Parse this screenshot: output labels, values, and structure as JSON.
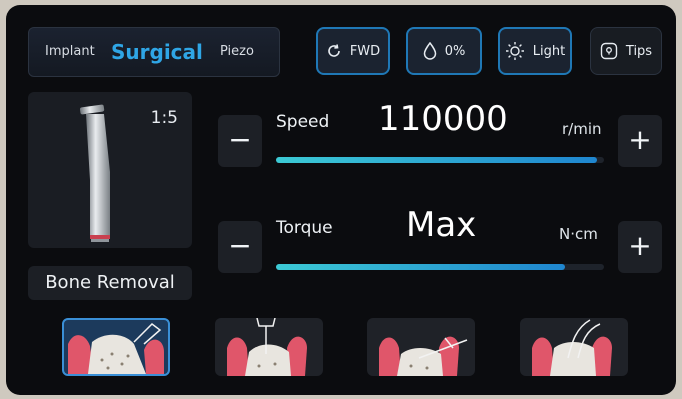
{
  "modes": [
    {
      "label": "Implant",
      "active": false
    },
    {
      "label": "Surgical",
      "active": true
    },
    {
      "label": "Piezo",
      "active": false
    }
  ],
  "direction": {
    "label": "FWD",
    "icon": "rotate-icon"
  },
  "irrigation": {
    "label": "0%",
    "icon": "water-drop-icon"
  },
  "light": {
    "label": "Light",
    "icon": "sun-icon"
  },
  "tips": {
    "label": "Tips",
    "icon": "tips-icon"
  },
  "handpiece": {
    "ratio": "1:5",
    "icon": "handpiece-icon"
  },
  "task": {
    "label": "Bone Removal"
  },
  "speed": {
    "label": "Speed",
    "value": "110000",
    "unit": "r/min",
    "fill_fraction": 0.98
  },
  "torque": {
    "label": "Torque",
    "value": "Max",
    "unit": "N·cm",
    "fill_fraction": 0.88
  },
  "controls": {
    "minus": "−",
    "plus": "+"
  },
  "procedures": [
    {
      "icon": "bone-cutting-icon",
      "selected": true
    },
    {
      "icon": "bone-drilling-icon",
      "selected": false
    },
    {
      "icon": "bone-cleaning-icon",
      "selected": false
    },
    {
      "icon": "root-extraction-icon",
      "selected": false
    }
  ],
  "colors": {
    "accent": "#2fa6e6",
    "background": "#0b0c0f",
    "slider_start": "#3ccad5",
    "slider_end": "#1f86cf",
    "gum": "#e0566a"
  }
}
